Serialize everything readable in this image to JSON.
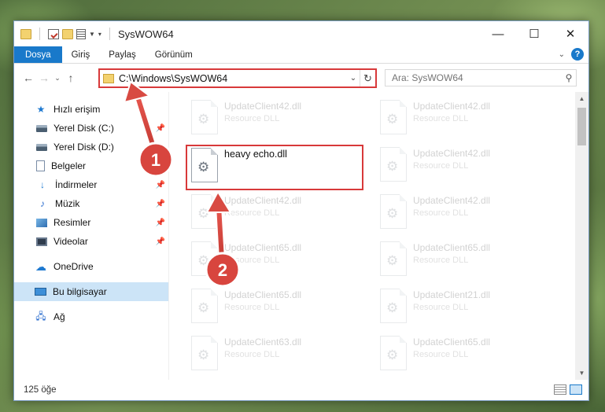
{
  "window": {
    "title": "SysWOW64",
    "controls": {
      "minimize": "—",
      "maximize": "☐",
      "close": "✕"
    }
  },
  "ribbon": {
    "tabs": [
      "Dosya",
      "Giriş",
      "Paylaş",
      "Görünüm"
    ],
    "help": "?"
  },
  "address": {
    "path": "C:\\Windows\\SysWOW64",
    "search_placeholder": "Ara: SysWOW64"
  },
  "nav_pane": {
    "quick_access": "Hızlı erişim",
    "items": [
      {
        "label": "Yerel Disk (C:)",
        "icon": "disk-icon",
        "pinned": true
      },
      {
        "label": "Yerel Disk (D:)",
        "icon": "disk-icon",
        "pinned": false
      },
      {
        "label": "Belgeler",
        "icon": "documents-icon",
        "pinned": true
      },
      {
        "label": "İndirmeler",
        "icon": "download-icon",
        "pinned": true
      },
      {
        "label": "Müzik",
        "icon": "music-icon",
        "pinned": true
      },
      {
        "label": "Resimler",
        "icon": "pictures-icon",
        "pinned": true
      },
      {
        "label": "Videolar",
        "icon": "videos-icon",
        "pinned": true
      }
    ],
    "onedrive": "OneDrive",
    "this_pc": "Bu bilgisayar",
    "network": "Ağ"
  },
  "files": {
    "left": [
      {
        "name": "UpdateClient42.dll",
        "type": "Resource DLL"
      },
      {
        "name": "heavy echo.dll",
        "type": ""
      },
      {
        "name": "UpdateClient42.dll",
        "type": "Resource DLL"
      },
      {
        "name": "UpdateClient65.dll",
        "type": "Resource DLL"
      },
      {
        "name": "UpdateClient65.dll",
        "type": "Resource DLL"
      },
      {
        "name": "UpdateClient63.dll",
        "type": "Resource DLL"
      }
    ],
    "right": [
      {
        "name": "UpdateClient42.dll",
        "type": "Resource DLL"
      },
      {
        "name": "UpdateClient42.dll",
        "type": "Resource DLL"
      },
      {
        "name": "UpdateClient42.dll",
        "type": "Resource DLL"
      },
      {
        "name": "UpdateClient65.dll",
        "type": "Resource DLL"
      },
      {
        "name": "UpdateClient21.dll",
        "type": "Resource DLL"
      },
      {
        "name": "UpdateClient65.dll",
        "type": "Resource DLL"
      }
    ]
  },
  "status": {
    "item_count": "125 öğe"
  },
  "annotations": {
    "step1": "1",
    "step2": "2"
  },
  "colors": {
    "accent": "#1979ca",
    "highlight": "#d8393a",
    "selection": "#cce4f7"
  }
}
